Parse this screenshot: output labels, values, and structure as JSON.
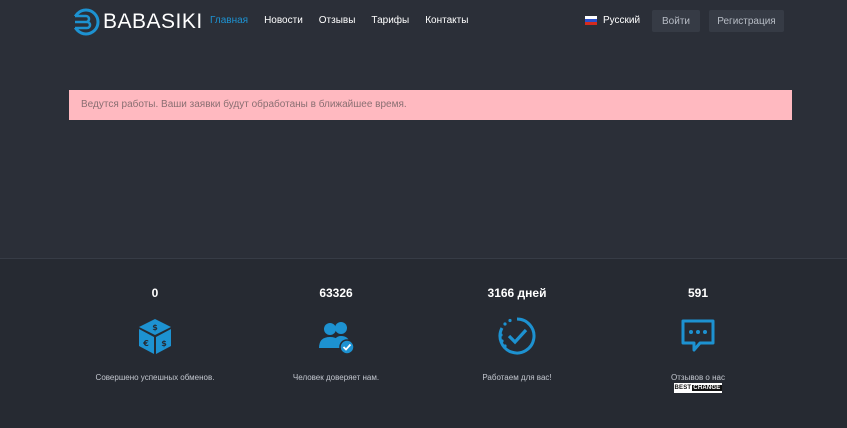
{
  "header": {
    "logo_text": "BABASIKI",
    "nav": [
      {
        "label": "Главная",
        "active": true
      },
      {
        "label": "Новости"
      },
      {
        "label": "Отзывы"
      },
      {
        "label": "Тарифы"
      },
      {
        "label": "Контакты"
      }
    ],
    "language": "Русский",
    "login_label": "Войти",
    "register_label": "Регистрация"
  },
  "alert": {
    "text": "Ведутся работы. Ваши заявки будут обработаны в ближайшее время."
  },
  "stats": [
    {
      "value": "0",
      "label": "Совершено успешных обменов.",
      "icon": "money-box-icon"
    },
    {
      "value": "63326",
      "label": "Человек доверяет нам.",
      "icon": "users-check-icon"
    },
    {
      "value": "3166 дней",
      "label": "Работаем для вас!",
      "icon": "circle-check-icon"
    },
    {
      "value": "591",
      "label": "Отзывов о нас",
      "icon": "chat-bubble-icon"
    }
  ],
  "bestchange": {
    "part1": "BEST",
    "part2": "CHANGE"
  },
  "colors": {
    "background": "#2b2f38",
    "footer": "#262a32",
    "accent": "#1d92d1",
    "alert_bg": "#ffb9c0"
  }
}
